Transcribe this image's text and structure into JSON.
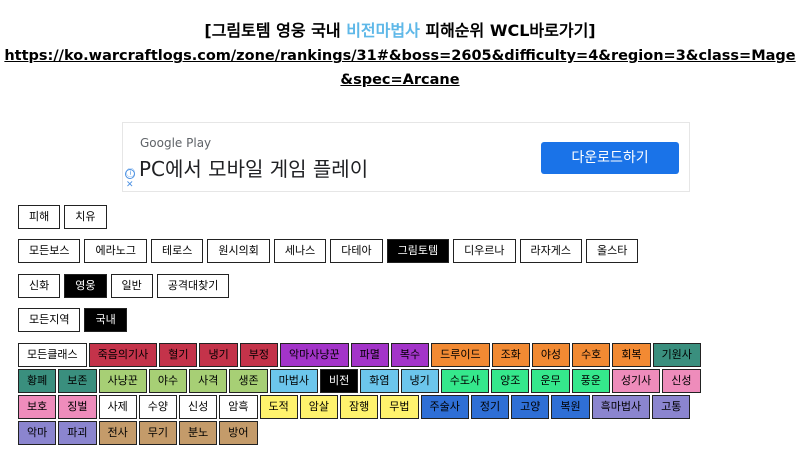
{
  "header": {
    "title_prefix": "[그림토템 영웅 국내 ",
    "title_accent": "비전마법사",
    "title_suffix": " 피해순위 WCL바로가기]",
    "url_line1": "https://ko.warcraftlogs.com/zone/rankings/31#&boss=2605&difficulty=4&region=3&class=Mage",
    "url_line2": "&spec=Arcane"
  },
  "ad": {
    "brand": "Google Play",
    "headline": "PC에서 모바일 게임 플레이",
    "cta": "다운로드하기",
    "info_icon": "ⓘ",
    "close_icon": "✕"
  },
  "metric_tabs": [
    {
      "label": "피해",
      "active": false
    },
    {
      "label": "치유",
      "active": false
    }
  ],
  "boss_tabs": [
    {
      "label": "모든보스",
      "active": false
    },
    {
      "label": "에라노그",
      "active": false
    },
    {
      "label": "테로스",
      "active": false
    },
    {
      "label": "원시의회",
      "active": false
    },
    {
      "label": "세나스",
      "active": false
    },
    {
      "label": "다테아",
      "active": false
    },
    {
      "label": "그림토템",
      "active": true
    },
    {
      "label": "디우르나",
      "active": false
    },
    {
      "label": "라자게스",
      "active": false
    },
    {
      "label": "올스타",
      "active": false
    }
  ],
  "difficulty_tabs": [
    {
      "label": "신화",
      "active": false
    },
    {
      "label": "영웅",
      "active": true
    },
    {
      "label": "일반",
      "active": false
    },
    {
      "label": "공격대찾기",
      "active": false
    }
  ],
  "region_tabs": [
    {
      "label": "모든지역",
      "active": false
    },
    {
      "label": "국내",
      "active": true
    }
  ],
  "class_rows": [
    [
      {
        "label": "모든클래스",
        "color": "#ffffff",
        "text": "#000000",
        "active": false
      },
      {
        "label": "죽음의기사",
        "color": "#c4334a",
        "text": "#000000"
      },
      {
        "label": "혈기",
        "color": "#c4334a",
        "text": "#000000"
      },
      {
        "label": "냉기",
        "color": "#c4334a",
        "text": "#000000"
      },
      {
        "label": "부정",
        "color": "#c4334a",
        "text": "#000000"
      },
      {
        "label": "악마사냥꾼",
        "color": "#a334c9",
        "text": "#000000"
      },
      {
        "label": "파멸",
        "color": "#a334c9",
        "text": "#000000"
      },
      {
        "label": "복수",
        "color": "#a334c9",
        "text": "#000000"
      },
      {
        "label": "드루이드",
        "color": "#f28a33",
        "text": "#000000"
      },
      {
        "label": "조화",
        "color": "#f28a33",
        "text": "#000000"
      },
      {
        "label": "야성",
        "color": "#f28a33",
        "text": "#000000"
      },
      {
        "label": "수호",
        "color": "#f28a33",
        "text": "#000000"
      },
      {
        "label": "회복",
        "color": "#f28a33",
        "text": "#000000"
      },
      {
        "label": "기원사",
        "color": "#3a8f7e",
        "text": "#000000"
      }
    ],
    [
      {
        "label": "황폐",
        "color": "#3a8f7e",
        "text": "#000000"
      },
      {
        "label": "보존",
        "color": "#3a8f7e",
        "text": "#000000"
      },
      {
        "label": "사냥꾼",
        "color": "#a7cf75",
        "text": "#000000"
      },
      {
        "label": "야수",
        "color": "#a7cf75",
        "text": "#000000"
      },
      {
        "label": "사격",
        "color": "#a7cf75",
        "text": "#000000"
      },
      {
        "label": "생존",
        "color": "#a7cf75",
        "text": "#000000"
      },
      {
        "label": "마법사",
        "color": "#6cc6ec",
        "text": "#000000"
      },
      {
        "label": "비전",
        "color": "#000000",
        "text": "#ffffff",
        "active": true
      },
      {
        "label": "화염",
        "color": "#6cc6ec",
        "text": "#000000"
      },
      {
        "label": "냉기",
        "color": "#6cc6ec",
        "text": "#000000"
      },
      {
        "label": "수도사",
        "color": "#35e88c",
        "text": "#000000"
      },
      {
        "label": "양조",
        "color": "#35e88c",
        "text": "#000000"
      },
      {
        "label": "운무",
        "color": "#35e88c",
        "text": "#000000"
      },
      {
        "label": "풍운",
        "color": "#35e88c",
        "text": "#000000"
      },
      {
        "label": "성기사",
        "color": "#ee8cbb",
        "text": "#000000"
      },
      {
        "label": "신성",
        "color": "#ee8cbb",
        "text": "#000000"
      }
    ],
    [
      {
        "label": "보호",
        "color": "#ee8cbb",
        "text": "#000000"
      },
      {
        "label": "징벌",
        "color": "#ee8cbb",
        "text": "#000000"
      },
      {
        "label": "사제",
        "color": "#ffffff",
        "text": "#000000"
      },
      {
        "label": "수양",
        "color": "#ffffff",
        "text": "#000000"
      },
      {
        "label": "신성",
        "color": "#ffffff",
        "text": "#000000"
      },
      {
        "label": "암흑",
        "color": "#ffffff",
        "text": "#000000"
      },
      {
        "label": "도적",
        "color": "#fff36d",
        "text": "#000000"
      },
      {
        "label": "암살",
        "color": "#fff36d",
        "text": "#000000"
      },
      {
        "label": "잠행",
        "color": "#fff36d",
        "text": "#000000"
      },
      {
        "label": "무법",
        "color": "#fff36d",
        "text": "#000000"
      },
      {
        "label": "주술사",
        "color": "#2f6fd6",
        "text": "#000000"
      },
      {
        "label": "정기",
        "color": "#2f6fd6",
        "text": "#000000"
      },
      {
        "label": "고양",
        "color": "#2f6fd6",
        "text": "#000000"
      },
      {
        "label": "복원",
        "color": "#2f6fd6",
        "text": "#000000"
      },
      {
        "label": "흑마법사",
        "color": "#8b85cf",
        "text": "#000000"
      },
      {
        "label": "고통",
        "color": "#8b85cf",
        "text": "#000000"
      }
    ],
    [
      {
        "label": "악마",
        "color": "#8b85cf",
        "text": "#000000"
      },
      {
        "label": "파괴",
        "color": "#8b85cf",
        "text": "#000000"
      },
      {
        "label": "전사",
        "color": "#c49b6a",
        "text": "#000000"
      },
      {
        "label": "무기",
        "color": "#c49b6a",
        "text": "#000000"
      },
      {
        "label": "분노",
        "color": "#c49b6a",
        "text": "#000000"
      },
      {
        "label": "방어",
        "color": "#c49b6a",
        "text": "#000000"
      }
    ]
  ]
}
